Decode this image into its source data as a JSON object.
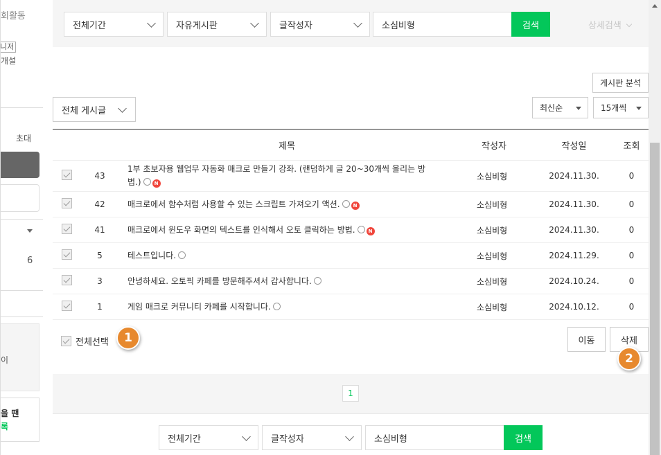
{
  "left_column": {
    "activity": "회활동",
    "manager_badge": "니저",
    "opened": "개설",
    "invite": "초대",
    "count": "6",
    "text_i": "이",
    "when_text": "을 땐",
    "green_text": "록"
  },
  "top_search": {
    "period": "전체기간",
    "board": "자유게시판",
    "field": "글작성자",
    "query": "소심비형",
    "search_button": "검색",
    "advanced": "상세검색"
  },
  "toolbar": {
    "board_analysis": "게시판 분석",
    "filter": "전체 게시글",
    "sort": "최신순",
    "per_page": "15개씩"
  },
  "table": {
    "headers": {
      "title": "제목",
      "author": "작성자",
      "date": "작성일",
      "views": "조회"
    },
    "rows": [
      {
        "num": "43",
        "title": "1부 초보자용 웹업무 자동화 매크로 만들기 강좌. (랜덤하게 글 20~30개씩 올리는 방법.)",
        "new": true,
        "author": "소심비형",
        "date": "2024.11.30.",
        "views": "0"
      },
      {
        "num": "42",
        "title": "매크로에서 함수처럼 사용할 수 있는 스크립트 가져오기 액션.",
        "new": true,
        "author": "소심비형",
        "date": "2024.11.30.",
        "views": "0"
      },
      {
        "num": "41",
        "title": "매크로에서 윈도우 화면의 텍스트를 인식해서 오토 클릭하는 방법.",
        "new": true,
        "author": "소심비형",
        "date": "2024.11.30.",
        "views": "0"
      },
      {
        "num": "5",
        "title": "테스트입니다.",
        "new": false,
        "author": "소심비형",
        "date": "2024.11.29.",
        "views": "0"
      },
      {
        "num": "3",
        "title": "안녕하세요. 오토픽 카페를 방문해주셔서 감사합니다.",
        "new": false,
        "author": "소심비형",
        "date": "2024.10.24.",
        "views": "0"
      },
      {
        "num": "1",
        "title": "게임 매크로 커뮤니티 카페를 시작합니다.",
        "new": false,
        "author": "소심비형",
        "date": "2024.10.12.",
        "views": "0"
      }
    ]
  },
  "bottom_actions": {
    "select_all": "전체선택",
    "move": "이동",
    "delete": "삭제",
    "badge1": "1",
    "badge2": "2"
  },
  "pagination": {
    "current": "1"
  },
  "bottom_search": {
    "period": "전체기간",
    "field": "글작성자",
    "query": "소심비형",
    "search_button": "검색"
  },
  "colors": {
    "green": "#03c75a",
    "badge": "#e7892e",
    "new_badge": "#f0463c"
  }
}
